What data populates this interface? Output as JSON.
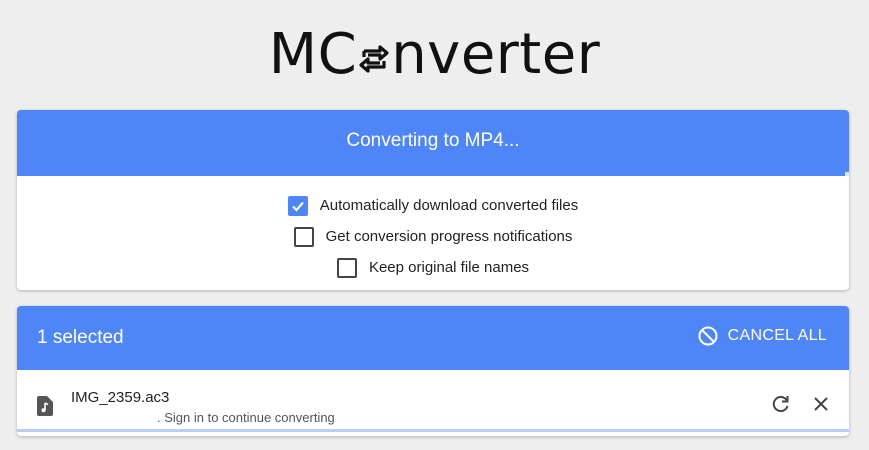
{
  "app": {
    "logo_prefix": "MC",
    "logo_suffix": "nverter"
  },
  "converting": {
    "title": "Converting to MP4...",
    "progress_fraction": 0.995
  },
  "options": [
    {
      "label": "Automatically download converted files",
      "checked": true
    },
    {
      "label": "Get conversion progress notifications",
      "checked": false
    },
    {
      "label": "Keep original file names",
      "checked": false
    }
  ],
  "selection": {
    "label": "1 selected",
    "cancel_all": "CANCEL ALL"
  },
  "files": [
    {
      "name": "IMG_2359.ac3",
      "status": ". Sign in to continue converting"
    }
  ],
  "colors": {
    "accent": "#4f86f7",
    "background": "#eeeeee"
  }
}
